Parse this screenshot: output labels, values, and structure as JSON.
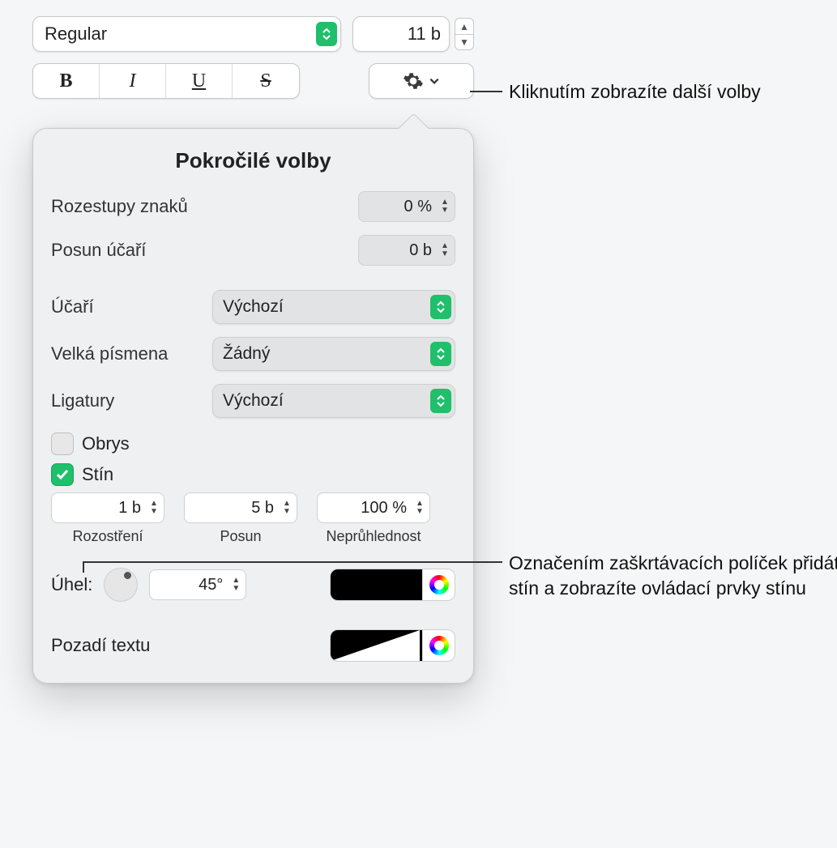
{
  "toolbar": {
    "font_style": "Regular",
    "font_size": "11 b",
    "bold": "B",
    "italic": "I",
    "underline": "U",
    "strike": "S"
  },
  "popover": {
    "title": "Pokročilé volby",
    "char_spacing_label": "Rozestupy znaků",
    "char_spacing_value": "0 %",
    "baseline_shift_label": "Posun účaří",
    "baseline_shift_value": "0 b",
    "baseline_label": "Účaří",
    "baseline_value": "Výchozí",
    "caps_label": "Velká písmena",
    "caps_value": "Žádný",
    "lig_label": "Ligatury",
    "lig_value": "Výchozí",
    "outline_label": "Obrys",
    "shadow_label": "Stín",
    "blur_value": "1 b",
    "blur_label": "Rozostření",
    "offset_value": "5 b",
    "offset_label": "Posun",
    "opacity_value": "100 %",
    "opacity_label": "Neprůhlednost",
    "angle_label": "Úhel:",
    "angle_value": "45°",
    "bgtext_label": "Pozadí textu"
  },
  "callouts": {
    "gear": "Kliknutím zobrazíte další volby",
    "shadow": "Označením zaškrtávacích políček přidáte stín a zobrazíte ovládací prvky stínu"
  }
}
